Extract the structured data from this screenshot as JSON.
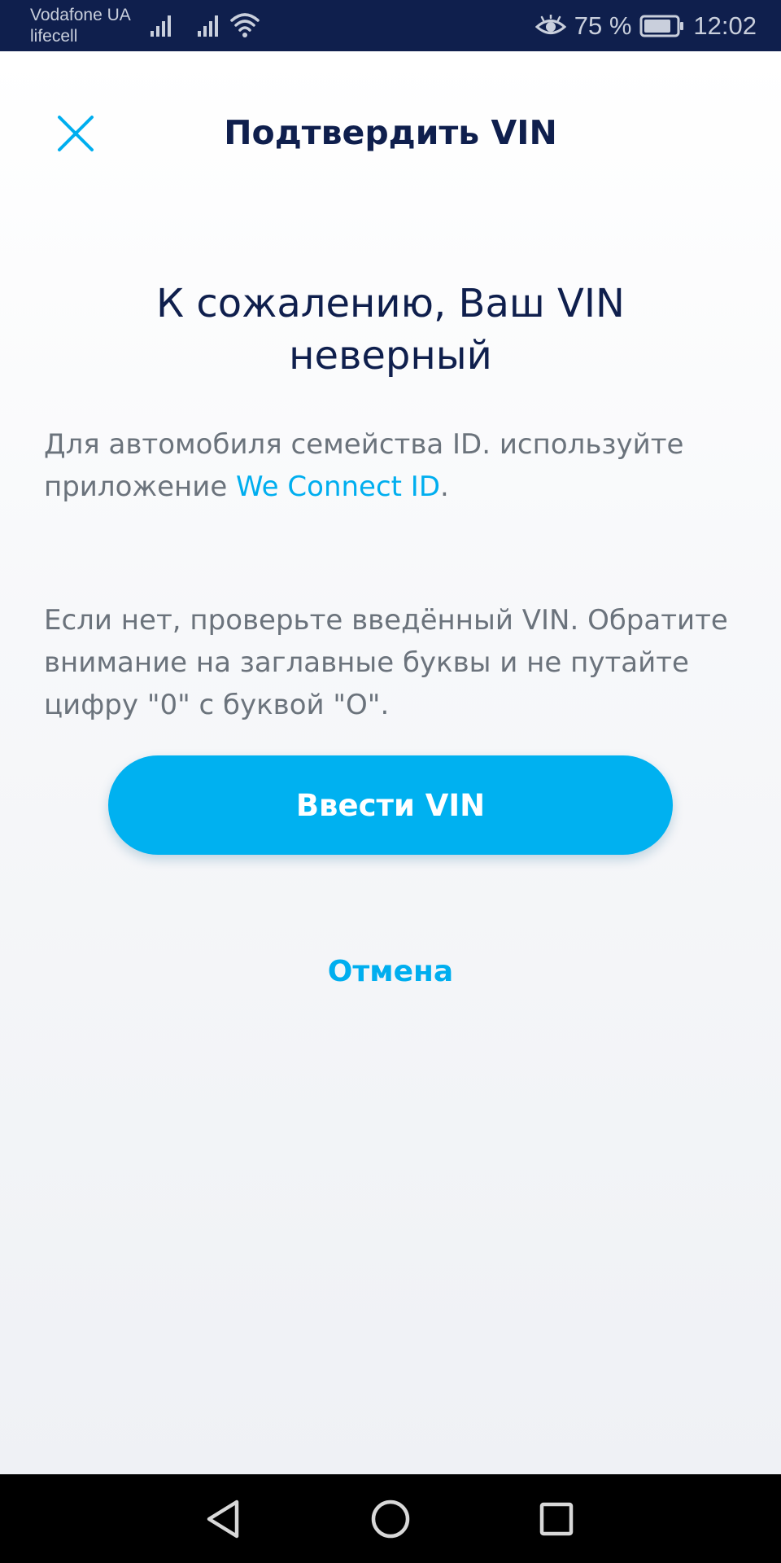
{
  "status_bar": {
    "carrier_1": "Vodafone UA",
    "carrier_2": "lifecell",
    "battery_percent": "75 %",
    "time": "12:02",
    "icons": [
      "cell-signal-icon",
      "cell-signal-icon",
      "wifi-icon",
      "eye-comfort-icon",
      "battery-icon"
    ]
  },
  "header": {
    "title": "Подтвердить VIN",
    "close_icon": "close-icon"
  },
  "content": {
    "headline": "К сожалению, Ваш VIN неверный",
    "paragraph1_before": "Для автомобиля семейства ID. используйте приложение ",
    "paragraph1_link": "We Connect ID",
    "paragraph1_after": ".",
    "paragraph2": "Если нет, проверьте введённый VIN. Обратите внимание на заглавные буквы и не путайте цифру \"0\" с буквой \"О\"."
  },
  "actions": {
    "primary_label": "Ввести VIN",
    "cancel_label": "Отмена"
  },
  "nav_bar": {
    "icons": [
      "back-icon",
      "home-icon",
      "recents-icon"
    ]
  },
  "colors": {
    "navy": "#0f1f4d",
    "accent": "#00b1f0",
    "body_text": "#6b737c",
    "status_bar_bg": "#0f1f4d"
  }
}
